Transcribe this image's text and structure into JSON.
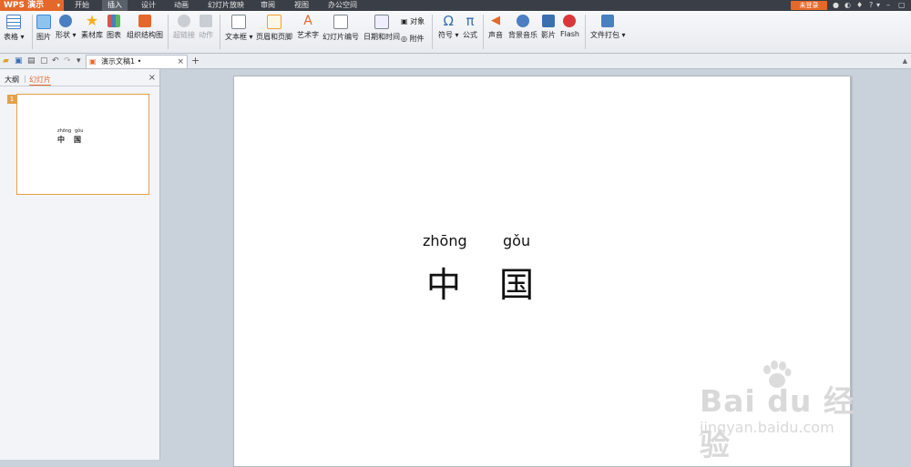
{
  "app": {
    "name": "WPS 演示",
    "login": "未登录"
  },
  "menu": [
    "开始",
    "插入",
    "设计",
    "动画",
    "幻灯片放映",
    "审阅",
    "视图",
    "办公空间"
  ],
  "ribbon": [
    {
      "label": "表格",
      "dropdown": true,
      "icon": "table-icon",
      "color": "#4a7fc1"
    },
    {
      "label": "图片",
      "icon": "picture-icon",
      "color": "#3e8ad6"
    },
    {
      "label": "形状",
      "dropdown": true,
      "icon": "shape-icon",
      "color": "#4a7fc1"
    },
    {
      "label": "素材库",
      "icon": "star-icon",
      "color": "#f2b01e"
    },
    {
      "label": "图表",
      "icon": "chart-icon",
      "color": "#d9534f"
    },
    {
      "label": "组织结构图",
      "icon": "org-chart-icon",
      "color": "#e4682a"
    },
    {
      "label": "超链接",
      "icon": "hyperlink-icon",
      "color": "#b0b6be",
      "disabled": true
    },
    {
      "label": "动作",
      "icon": "action-icon",
      "color": "#b0b6be",
      "disabled": true
    },
    {
      "label": "文本框",
      "dropdown": true,
      "icon": "textbox-icon",
      "color": "#7d8590"
    },
    {
      "label": "页眉和页脚",
      "icon": "header-footer-icon",
      "color": "#f0a030"
    },
    {
      "label": "艺术字",
      "icon": "wordart-icon",
      "color": "#e4682a"
    },
    {
      "label": "幻灯片编号",
      "icon": "slide-number-icon",
      "color": "#7d8590"
    },
    {
      "label": "日期和时间",
      "icon": "datetime-icon",
      "color": "#7d8590"
    },
    {
      "label": "对象",
      "icon": "object-icon",
      "color": "#7d8590"
    },
    {
      "label": "附件",
      "icon": "attachment-icon",
      "color": "#7d8590"
    },
    {
      "label": "符号",
      "dropdown": true,
      "icon": "omega-icon",
      "color": "#3a6fb0"
    },
    {
      "label": "公式",
      "icon": "pi-icon",
      "color": "#3a6fb0"
    },
    {
      "label": "声音",
      "icon": "sound-icon",
      "color": "#e4682a"
    },
    {
      "label": "背景音乐",
      "icon": "music-icon",
      "color": "#4a7fc1"
    },
    {
      "label": "影片",
      "icon": "film-icon",
      "color": "#3a6fb0"
    },
    {
      "label": "Flash",
      "icon": "flash-icon",
      "color": "#d9383a"
    },
    {
      "label": "文件打包",
      "dropdown": true,
      "icon": "package-icon",
      "color": "#4a7fc1"
    }
  ],
  "tabbar": {
    "doc_title": "演示文稿1 •"
  },
  "pane": {
    "outline_tab": "大纲",
    "slides_tab": "幻灯片",
    "slide_number": "1"
  },
  "slide": {
    "pinyin": [
      "zhōng",
      "gǒu"
    ],
    "hanzi": [
      "中",
      "国"
    ]
  },
  "watermark": {
    "brand": "Bai  du 经验",
    "url": "jingyan.baidu.com"
  }
}
